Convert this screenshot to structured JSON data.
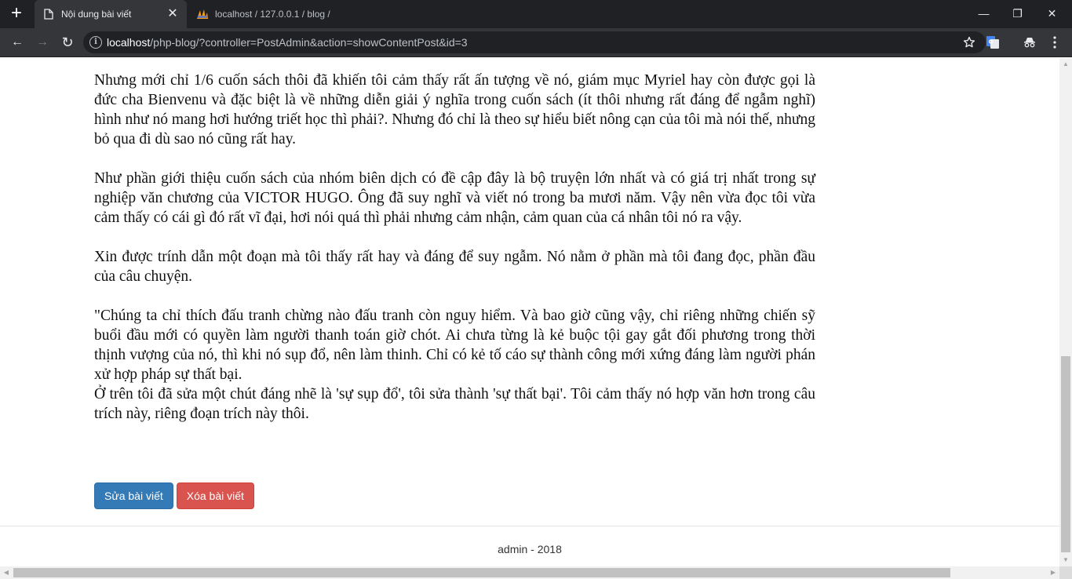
{
  "browser": {
    "new_tab_glyph": "+",
    "tabs": [
      {
        "title": "Nội dung bài viết",
        "active": true,
        "close_glyph": "✕"
      },
      {
        "title": "localhost / 127.0.0.1 / blog /",
        "active": false
      }
    ],
    "window_controls": {
      "minimize": "—",
      "maximize": "❐",
      "close": "✕"
    },
    "toolbar": {
      "back": "←",
      "forward": "→",
      "reload": "↻"
    },
    "address": {
      "host": "localhost",
      "path": "/php-blog/?controller=PostAdmin&action=showContentPost&id=3"
    },
    "icons": [
      "plus-icon",
      "page-icon",
      "phpmyadmin-icon",
      "close-icon",
      "back-arrow-icon",
      "forward-arrow-icon",
      "reload-icon",
      "info-icon",
      "star-icon",
      "translate-icon",
      "incognito-icon",
      "menu-dots-icon"
    ]
  },
  "article": {
    "paragraphs": [
      "Nhưng mới chỉ 1/6 cuốn sách thôi đã khiến tôi cảm thấy rất ấn tượng về nó, giám mục Myriel hay còn được gọi là đức cha Bienvenu và đặc biệt là về những diễn giải ý nghĩa trong cuốn sách (ít thôi nhưng rất đáng để ngẫm nghĩ) hình như nó mang hơi hướng triết học thì phải?. Nhưng đó chỉ là theo sự hiểu biết nông cạn của tôi mà nói thế, nhưng bỏ qua đi dù sao nó cũng rất hay.",
      "Như phần giới thiệu cuốn sách của nhóm biên dịch có đề cập đây là bộ truyện lớn nhất và có giá trị nhất trong sự nghiệp văn chương của VICTOR HUGO. Ông đã suy nghĩ và viết nó trong ba mươi năm. Vậy nên vừa đọc tôi vừa cảm thấy có cái gì đó rất vĩ đại, hơi nói quá thì phải nhưng cảm nhận, cảm quan của cá nhân tôi nó ra vậy.",
      "Xin được trính dẫn một đoạn mà tôi thấy rất hay và đáng để suy ngẫm. Nó nằm ở phần mà tôi đang đọc, phần đầu của câu chuyện.",
      "\"Chúng ta chỉ thích đấu tranh chừng nào đấu tranh còn nguy hiểm. Và bao giờ cũng vậy, chỉ riêng những chiến sỹ buổi đầu mới có quyền làm người thanh toán giờ chót. Ai chưa từng là kẻ buộc tội gay gắt đối phương trong thời thịnh vượng của nó, thì khi nó sụp đổ, nên làm thinh. Chỉ có kẻ tố cáo sự thành công mới xứng đáng làm người phán xử hợp pháp sự thất bại.",
      "Ở trên tôi đã sửa một chút đáng nhẽ là 'sự sụp đổ', tôi sửa thành 'sự thất bại'. Tôi cảm thấy nó hợp văn hơn trong câu trích này, riêng đoạn trích này thôi."
    ]
  },
  "actions": {
    "edit_label": "Sửa bài viết",
    "delete_label": "Xóa bài viết"
  },
  "footer": {
    "text": "admin - 2018"
  },
  "colors": {
    "primary": "#337ab7",
    "danger": "#d9534f",
    "chrome_dark": "#202124",
    "chrome_toolbar": "#35363a"
  }
}
